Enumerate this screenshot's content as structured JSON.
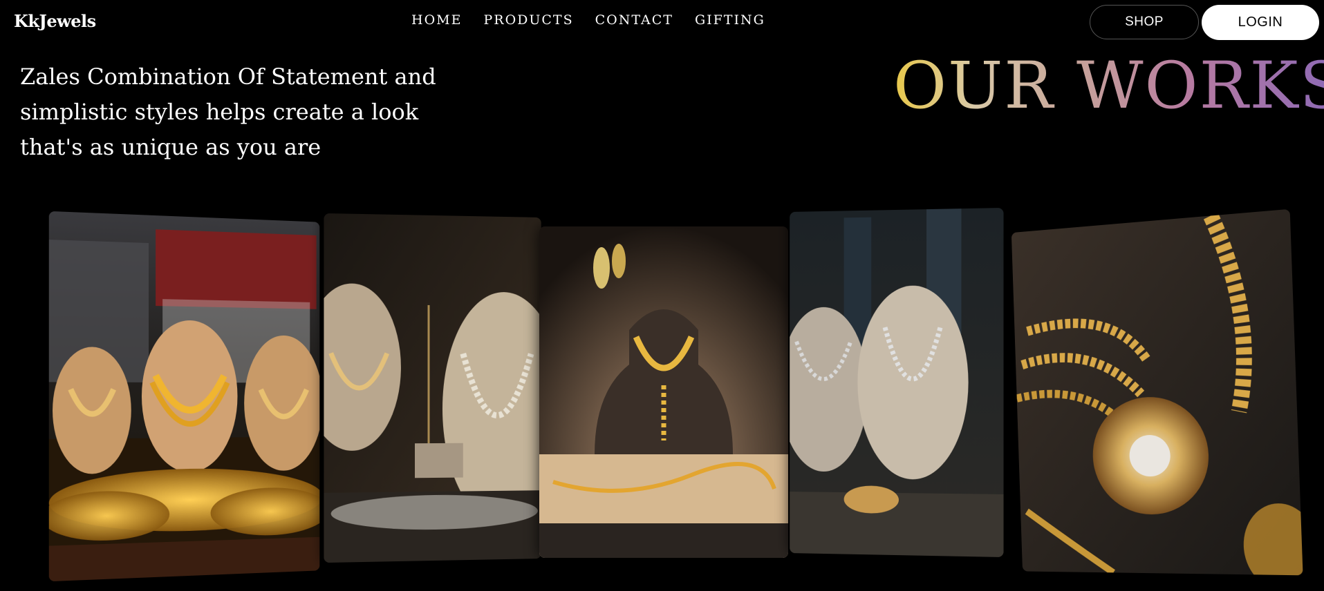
{
  "navbar": {
    "brand": "KkJewels",
    "links": [
      "HOME",
      "PRODUCTS",
      "CONTACT",
      "GIFTING"
    ],
    "shop_label": "SHOP",
    "login_label": "LOGIN"
  },
  "hero": {
    "tagline": "Zales Combination Of Statement and simplistic styles helps create a look that's as unique as you are",
    "title": "OUR WORKS"
  },
  "gallery": {
    "images": [
      "jewelry-store-window-image",
      "necklace-display-image",
      "pendant-bust-image",
      "necklace-showcase-image",
      "gold-necklace-closeup-image"
    ]
  }
}
